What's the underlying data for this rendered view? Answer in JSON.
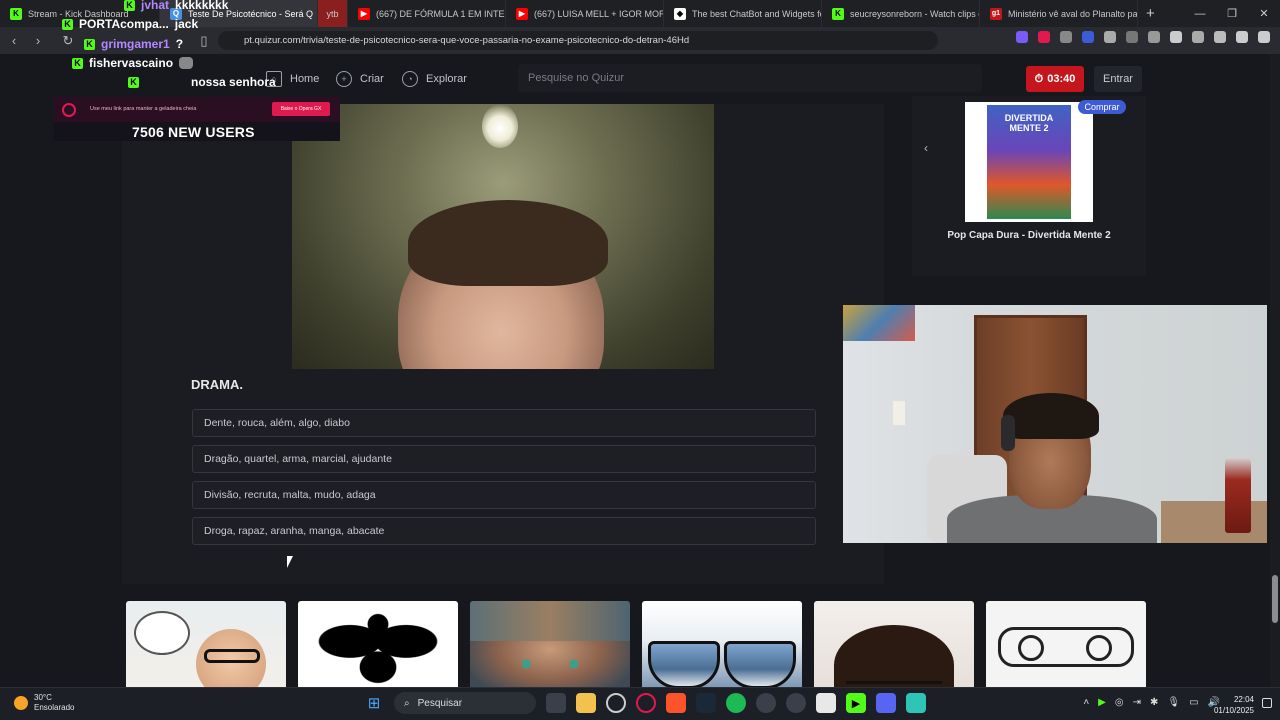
{
  "browser": {
    "tabs": [
      {
        "label": "Stream - Kick Dashboard",
        "color": "#53fc18",
        "letter": "K"
      },
      {
        "label": "Teste De Psicotécnico - Será Q",
        "color": "#4a90e2",
        "letter": "Q",
        "active": true
      },
      {
        "label": "ytb",
        "color": "#c22",
        "letter": ""
      },
      {
        "label": "(667) DE FÓRMULA 1 EM INTERLAG",
        "color": "#ff0000",
        "letter": "▶"
      },
      {
        "label": "(667) LUISA MELL + IGOR MORAIS",
        "color": "#ff0000",
        "letter": "▶"
      },
      {
        "label": "The best ChatBot and Widgets for",
        "color": "#ffffff",
        "letter": "◆"
      },
      {
        "label": "seucreysonreborn - Watch clips on",
        "color": "#53fc18",
        "letter": "K"
      },
      {
        "label": "Ministério vê aval do Planalto para",
        "color": "#c4161c",
        "letter": "g1"
      }
    ],
    "url": "pt.quizur.com/trivia/teste-de-psicotecnico-sera-que-voce-passaria-no-exame-psicotecnico-do-detran-46Hd"
  },
  "stream_overlay": {
    "chat": [
      {
        "user": "jvhat",
        "message": "kkkkkkkk"
      },
      {
        "user": "PORTAcompa...",
        "message": "jack"
      },
      {
        "user": "grimgamer1",
        "message": "?"
      },
      {
        "user": "fishervascaino",
        "message": ""
      },
      {
        "user": "",
        "message": "nossa senhora"
      }
    ],
    "ad_text": "Use meu link para manter a geladeira cheia",
    "ad_button": "Baixe o Opera GX",
    "new_users": "7506 NEW USERS"
  },
  "site": {
    "nav": {
      "home": "Home",
      "create": "Criar",
      "explore": "Explorar"
    },
    "search_placeholder": "Pesquise no Quizur",
    "timer": "03:40",
    "login": "Entrar"
  },
  "question": {
    "title": "DRAMA.",
    "answers": [
      "Dente, rouca, além, algo, diabo",
      "Dragão, quartel, arma, marcial, ajudante",
      "Divisão, recruta, malta, mudo, adaga",
      "Droga, rapaz, aranha, manga, abacate"
    ]
  },
  "product": {
    "badge": "Comprar",
    "name": "Pop Capa Dura - Divertida Mente 2",
    "cover_title": "DIVERTIDA MENTE 2"
  },
  "taskbar": {
    "temp": "30°C",
    "weather": "Ensolarado",
    "search": "Pesquisar",
    "time": "22:04",
    "date": "01/10/2025"
  },
  "icons": [
    "back-icon",
    "forward-icon",
    "reload-icon",
    "bookmark-icon",
    "home-icon",
    "create-icon",
    "explore-icon",
    "timer-icon",
    "search-icon",
    "windows-icon"
  ]
}
